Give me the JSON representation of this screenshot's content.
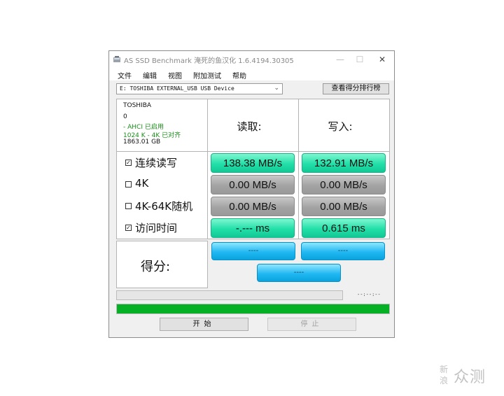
{
  "window": {
    "title": "AS SSD Benchmark 淹死的鱼汉化 1.6.4194.30305",
    "minimize": "—",
    "maximize": "☐",
    "close": "✕"
  },
  "menu": [
    "文件",
    "编辑",
    "视图",
    "附加测试",
    "帮助"
  ],
  "drive": {
    "selected": "E: TOSHIBA EXTERNAL_USB USB Device",
    "rank_button": "查看得分排行榜"
  },
  "info": {
    "name": "TOSHIBA",
    "firmware": "0",
    "ahci": "- AHCI 已启用",
    "align": "1024 K - 4K 已对齐",
    "size": "1863.01 GB",
    "status_color": "#1a8f1a"
  },
  "headers": {
    "read": "读取:",
    "write": "写入:"
  },
  "rows": [
    {
      "checked": true,
      "label": "连续读写",
      "read": "138.38 MB/s",
      "write": "132.91 MB/s",
      "read_state": "on",
      "write_state": "on"
    },
    {
      "checked": false,
      "label": "4K",
      "read": "0.00 MB/s",
      "write": "0.00 MB/s",
      "read_state": "off",
      "write_state": "off"
    },
    {
      "checked": false,
      "label": "4K-64K随机",
      "read": "0.00 MB/s",
      "write": "0.00 MB/s",
      "read_state": "off",
      "write_state": "off"
    },
    {
      "checked": true,
      "label": "访问时间",
      "read": "-.--- ms",
      "write": "0.615 ms",
      "read_state": "on",
      "write_state": "on"
    }
  ],
  "score": {
    "label": "得分:",
    "read": "----",
    "write": "----",
    "total": "----"
  },
  "progress": {
    "time": "--:--:--",
    "bar_fill": 1.0,
    "bar_color": "#06b025"
  },
  "buttons": {
    "start": "开始",
    "stop": "停止"
  },
  "watermark": {
    "small_top": "新",
    "small_bottom": "浪",
    "big": "众测"
  }
}
